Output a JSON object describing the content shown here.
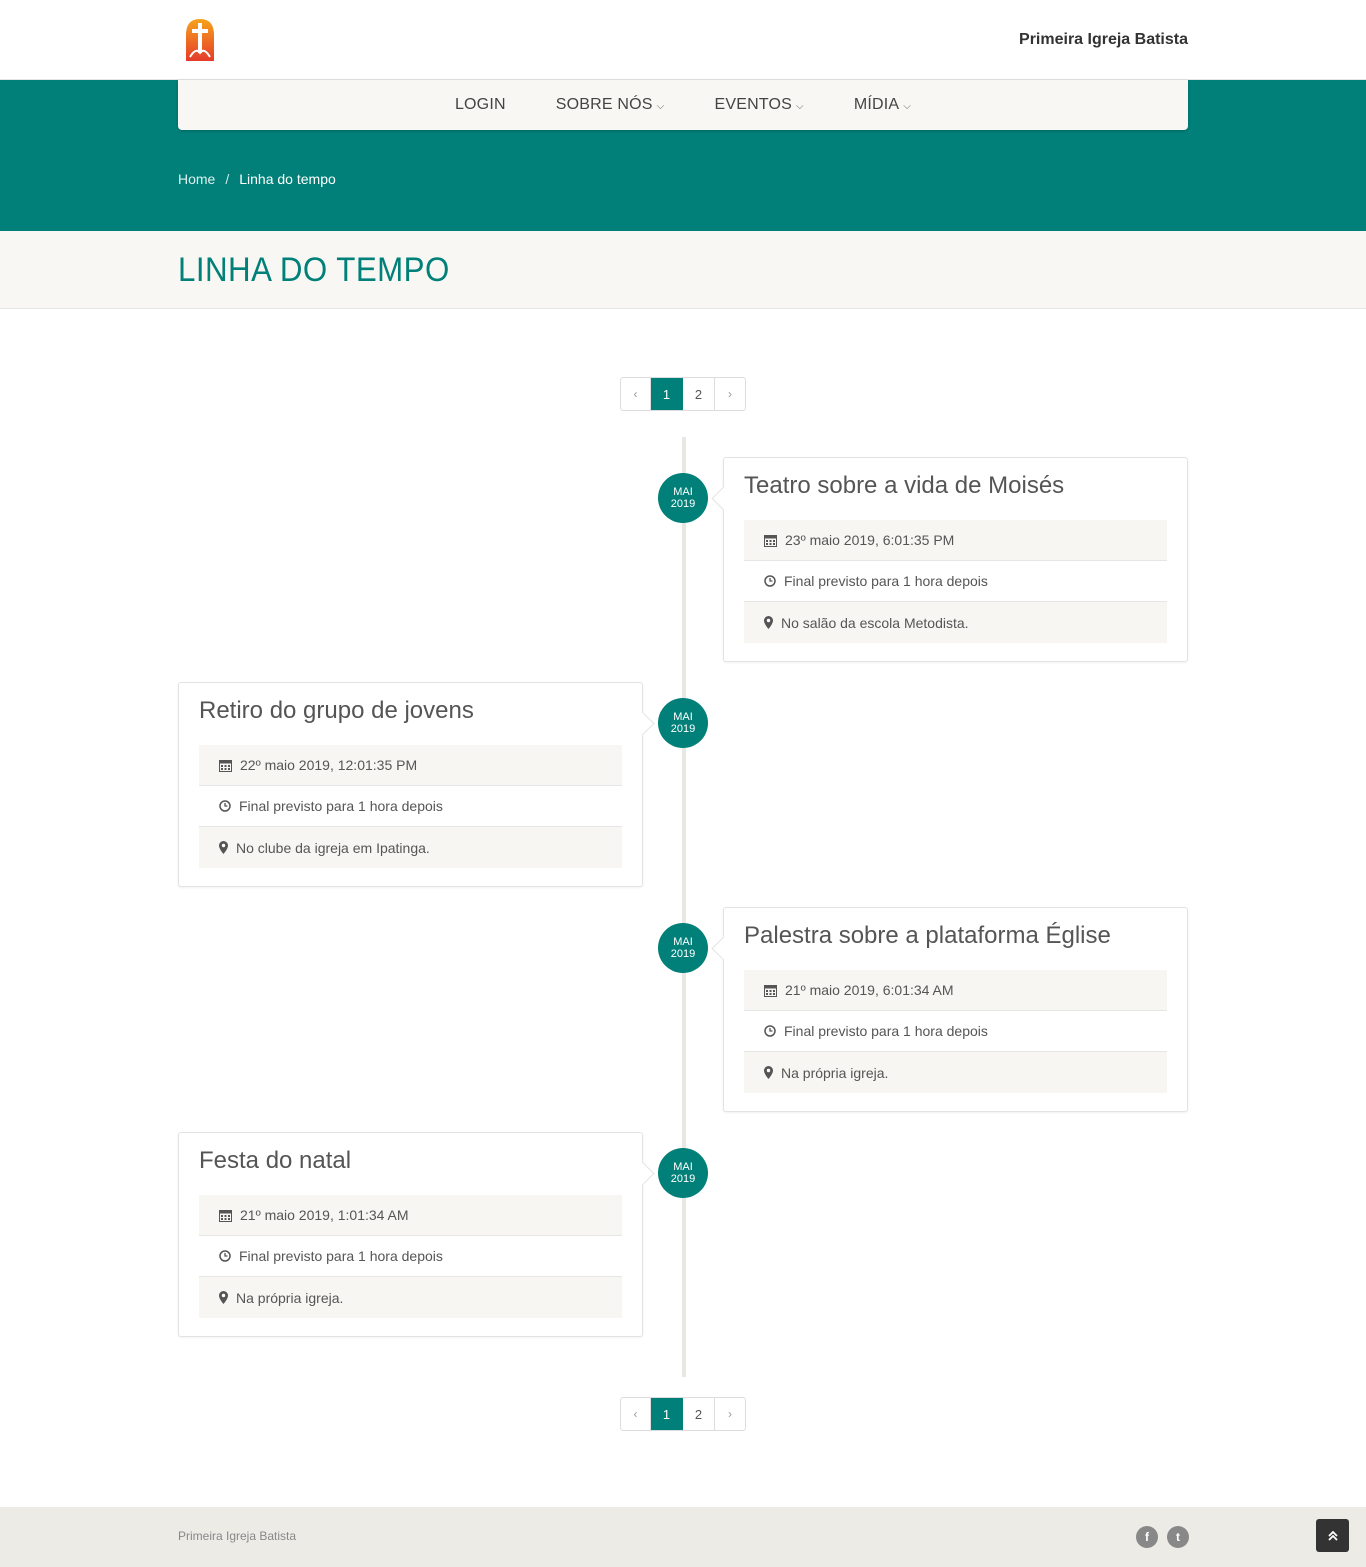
{
  "header": {
    "site_name": "Primeira Igreja Batista",
    "logo_icon": "church-cross-logo-icon"
  },
  "nav": {
    "items": [
      {
        "label": "LOGIN",
        "dropdown": false
      },
      {
        "label": "SOBRE NÓS",
        "dropdown": true
      },
      {
        "label": "EVENTOS",
        "dropdown": true
      },
      {
        "label": "MÍDIA",
        "dropdown": true
      }
    ]
  },
  "breadcrumb": {
    "home": "Home",
    "separator": "/",
    "current": "Linha do tempo"
  },
  "page": {
    "title": "LINHA DO TEMPO"
  },
  "pagination": {
    "prev": "‹",
    "pages": [
      "1",
      "2"
    ],
    "active": "1",
    "next": "›"
  },
  "events": [
    {
      "month": "MAI",
      "year": "2019",
      "title": "Teatro sobre a vida de Moisés",
      "date": "23º maio 2019, 6:01:35 PM",
      "duration": "Final previsto para 1 hora depois",
      "location": "No salão da escola Metodista."
    },
    {
      "month": "MAI",
      "year": "2019",
      "title": "Retiro do grupo de jovens",
      "date": "22º maio 2019, 12:01:35 PM",
      "duration": "Final previsto para 1 hora depois",
      "location": "No clube da igreja em Ipatinga."
    },
    {
      "month": "MAI",
      "year": "2019",
      "title": "Palestra sobre a plataforma Église",
      "date": "21º maio 2019, 6:01:34 AM",
      "duration": "Final previsto para 1 hora depois",
      "location": "Na própria igreja."
    },
    {
      "month": "MAI",
      "year": "2019",
      "title": "Festa do natal",
      "date": "21º maio 2019, 1:01:34 AM",
      "duration": "Final previsto para 1 hora depois",
      "location": "Na própria igreja."
    }
  ],
  "footer": {
    "text": "Primeira Igreja Batista",
    "social": [
      {
        "icon": "facebook-icon",
        "glyph": "f"
      },
      {
        "icon": "twitter-icon",
        "glyph": "t"
      }
    ],
    "to_top_icon": "double-chevron-up-icon"
  },
  "colors": {
    "brand": "#008079",
    "light_bg": "#f8f7f3",
    "footer_bg": "#ecebe6"
  }
}
